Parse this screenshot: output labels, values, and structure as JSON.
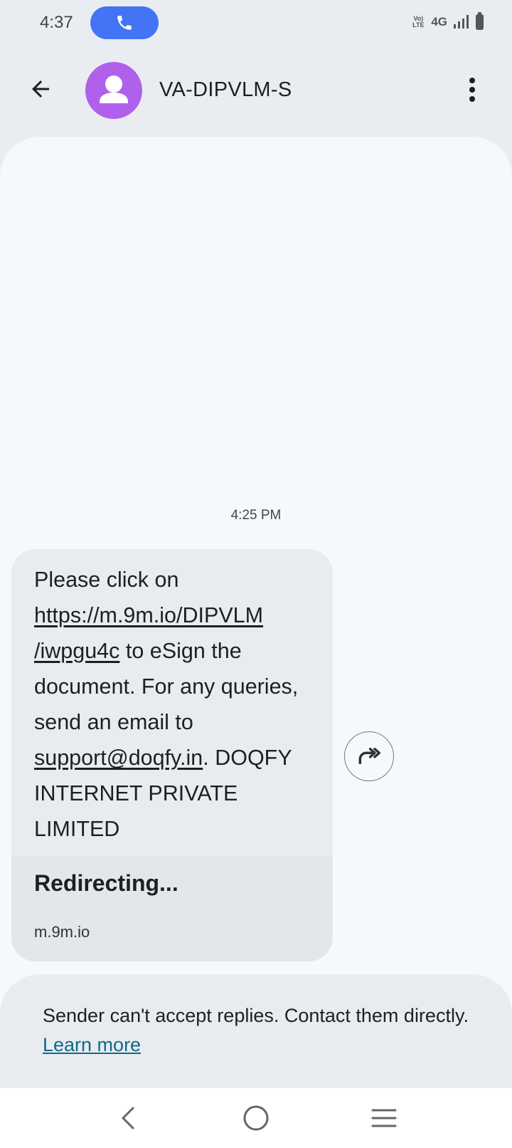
{
  "status_bar": {
    "time": "4:37",
    "call_icon": "phone-icon",
    "volte_label": "Vo) LTE",
    "network": "4G",
    "signal_icon": "signal-bars-icon",
    "battery_icon": "battery-icon"
  },
  "header": {
    "back_icon": "arrow-back-icon",
    "contact_name": "VA-DIPVLM-S",
    "avatar_icon": "person-avatar-icon",
    "avatar_color": "#b061ec",
    "menu_icon": "more-vert-icon"
  },
  "conversation": {
    "timestamp": "4:25 PM",
    "message": {
      "text_1": "Please click on ",
      "link_url": "https://m.9m.io/DIPVLM/iwpgu4c",
      "link_line_1": "https://m.9m.io/DIPVLM",
      "link_line_2": "/iwpgu4c",
      "text_2": " to eSign the document. For any queries, send an email to ",
      "email": "support@doqfy.in",
      "text_3": ". DOQFY INTERNET PRIVATE LIMITED"
    },
    "preview": {
      "title": "Redirecting...",
      "domain": "m.9m.io"
    },
    "forward_icon": "forward-share-icon"
  },
  "notice": {
    "text": "Sender can't accept replies. Contact them directly. ",
    "link_label": "Learn more"
  },
  "nav_bar": {
    "back_icon": "nav-back-icon",
    "home_icon": "nav-home-icon",
    "recents_icon": "nav-recents-icon"
  },
  "colors": {
    "call_pill": "#4374f5",
    "background": "#e9edf2",
    "conversation_bg": "#f5f9fd",
    "bubble": "#e9ecef",
    "link": "#0e6a8a"
  }
}
